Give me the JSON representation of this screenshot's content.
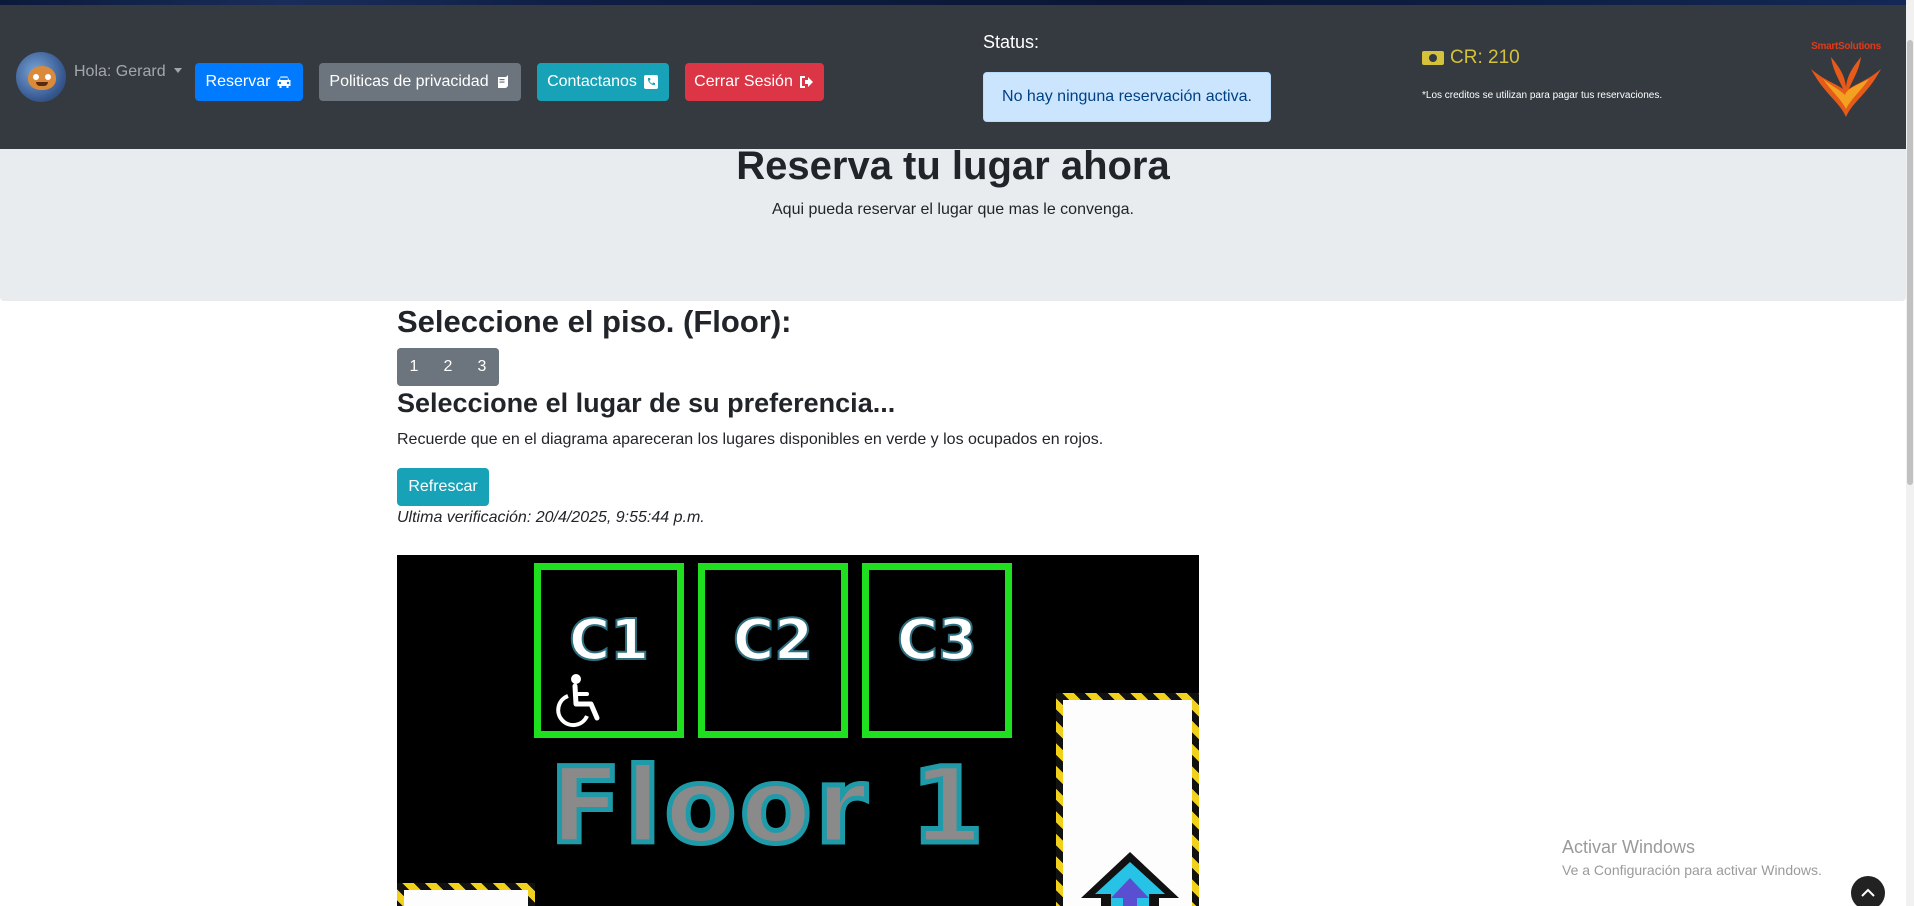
{
  "navbar": {
    "user_greeting": "Hola: Gerard",
    "buttons": {
      "reservar": "Reservar",
      "politicas": "Politicas de privacidad",
      "contacto": "Contactanos",
      "cerrar": "Cerrar Sesión"
    },
    "status_label": "Status:",
    "status_message": "No hay ninguna reservación activa.",
    "credits": "CR: 210",
    "credits_note": "*Los creditos se utilizan para pagar tus reservaciones.",
    "logo_text": "SmartSolutions",
    "colors": {
      "primary": "#007bff",
      "secondary": "#6c757d",
      "info": "#17a2b8",
      "danger": "#dc3545",
      "navbar_bg": "#343a40",
      "credits": "#d4c23a"
    }
  },
  "jumbotron": {
    "title": "Reserva tu lugar ahora",
    "lead": "Aqui pueda reservar el lugar que mas le convenga."
  },
  "main": {
    "floor_heading": "Seleccione el piso. (Floor):",
    "floors": [
      "1",
      "2",
      "3"
    ],
    "spot_heading": "Seleccione el lugar de su preferencia...",
    "hint": "Recuerde que en el diagrama apareceran los lugares disponibles en verde y los ocupados en rojos.",
    "refresh_label": "Refrescar",
    "last_check": "Ultima verificación: 20/4/2025, 9:55:44 p.m."
  },
  "diagram": {
    "spots": [
      {
        "label": "C1",
        "status": "available",
        "accessible": true
      },
      {
        "label": "C2",
        "status": "available",
        "accessible": false
      },
      {
        "label": "C3",
        "status": "available",
        "accessible": false
      }
    ],
    "floor_label": "Floor 1",
    "available_color": "#1fe01f"
  },
  "overlay": {
    "activate_title": "Activar Windows",
    "activate_sub": "Ve a Configuración para activar Windows."
  },
  "icons": [
    "car-icon",
    "book-icon",
    "phone-icon",
    "sign-out-icon",
    "money-icon",
    "wheelchair-icon",
    "up-arrow-icon",
    "chevron-up-icon"
  ]
}
